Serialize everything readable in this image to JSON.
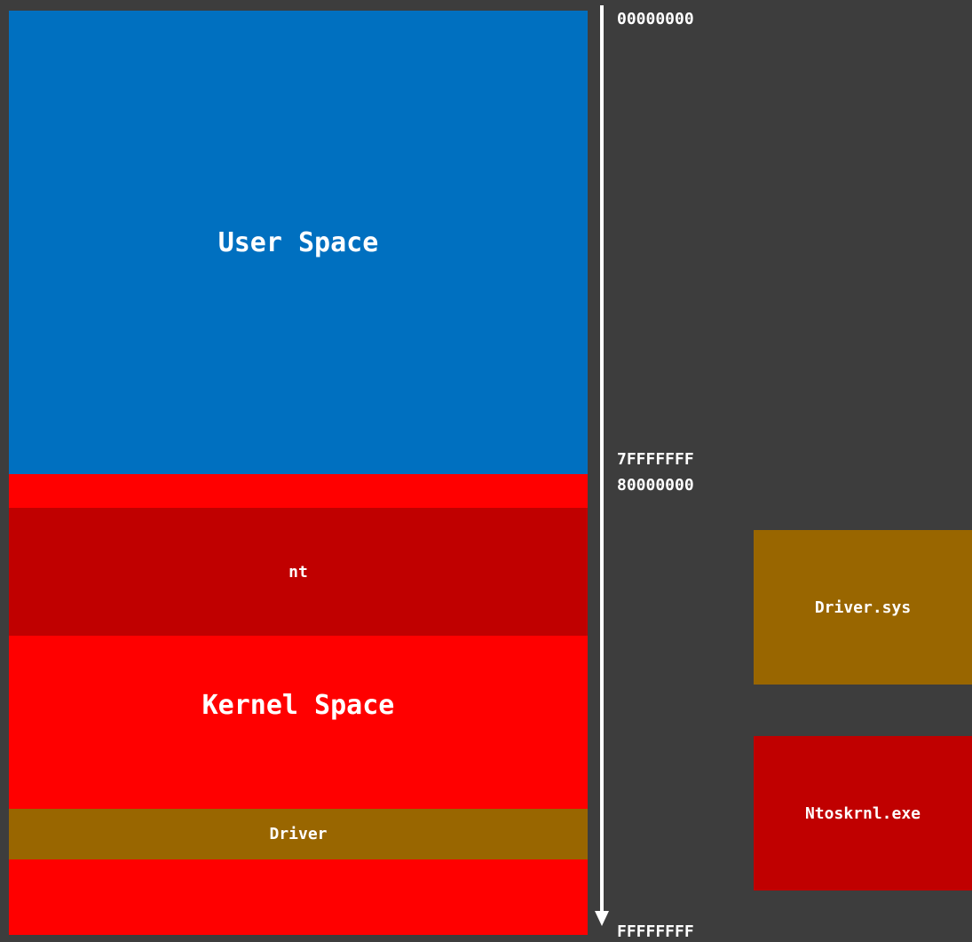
{
  "regions": {
    "user_space": {
      "label": "User Space",
      "color": "#0070c0"
    },
    "kernel_space": {
      "label": "Kernel Space",
      "color": "#ff0000"
    },
    "nt": {
      "label": "nt",
      "color": "#c00000"
    },
    "driver": {
      "label": "Driver",
      "color": "#996600"
    }
  },
  "addresses": {
    "start": "00000000",
    "user_end": "7FFFFFFF",
    "kernel_start": "80000000",
    "end": "FFFFFFFF"
  },
  "modules": {
    "driver_sys": {
      "label": "Driver.sys",
      "color": "#996600"
    },
    "ntoskrnl": {
      "label": "Ntoskrnl.exe",
      "color": "#c00000"
    }
  },
  "colors": {
    "background": "#3d3d3d",
    "arrow": "#ffffff",
    "text": "#ffffff"
  }
}
